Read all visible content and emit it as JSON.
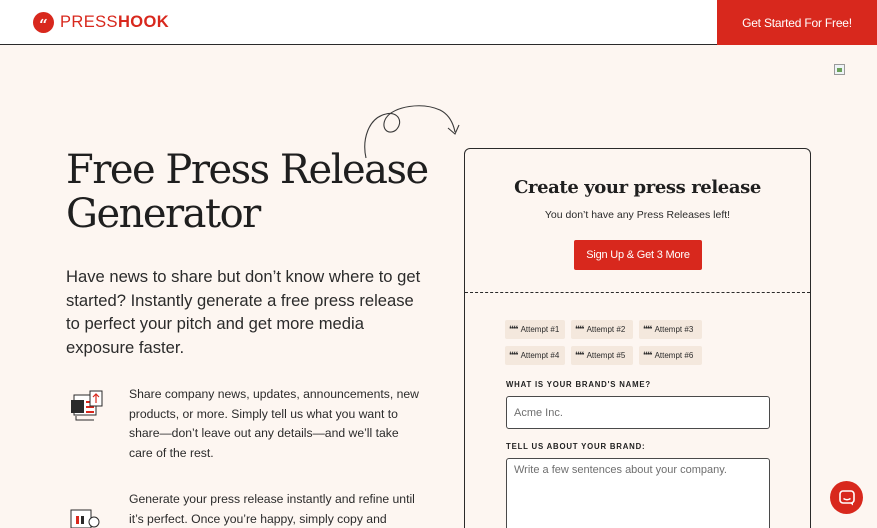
{
  "header": {
    "logo_mark": "“",
    "logo_word_light": "PRESS",
    "logo_word_bold": "HOOK",
    "cta_label": "Get Started For Free!"
  },
  "hero": {
    "title": "Free Press Release Generator",
    "subtitle": "Have news to share but don’t know where to get started? Instantly generate a free press release to perfect your pitch and get more media exposure faster."
  },
  "features": [
    {
      "icon": "news-share-icon",
      "text": "Share company news, updates, announcements, new products, or more. Simply tell us what you want to share—don’t leave out any details—and we’ll take care of the rest."
    },
    {
      "icon": "document-edit-icon",
      "text": "Generate your press release instantly and refine until it’s perfect. Once you’re happy, simply copy and paste"
    }
  ],
  "form": {
    "title": "Create your press release",
    "message": "You don’t have any Press Releases left!",
    "signup_label": "Sign Up & Get 3 More",
    "attempts": [
      "Attempt #1",
      "Attempt #2",
      "Attempt #3",
      "Attempt #4",
      "Attempt #5",
      "Attempt #6"
    ],
    "brand_name_label": "WHAT IS YOUR BRAND'S NAME?",
    "brand_name_placeholder": "Acme Inc.",
    "brand_about_label": "TELL US ABOUT YOUR BRAND:",
    "brand_about_placeholder": "Write a few sentences about your company."
  },
  "colors": {
    "accent": "#d8281d",
    "background": "#fdf6f1",
    "chip": "#f4e8dd"
  }
}
